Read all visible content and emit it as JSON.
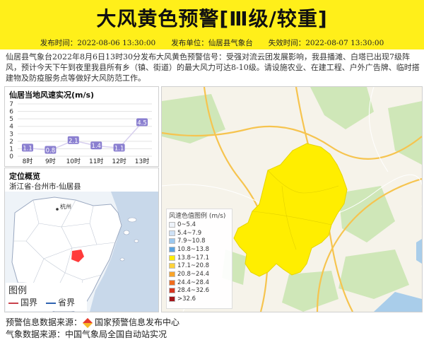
{
  "header": {
    "title": "大风黄色预警[Ⅲ级/较重]",
    "published_label": "发布时间：",
    "published": "2022-08-06 13:30:00",
    "issuer_label": "发布单位：",
    "issuer": "仙居县气象台",
    "expire_label": "失效时间：",
    "expire": "2022-08-07 13:30:00",
    "banner_color": "#ffef1a"
  },
  "description": "仙居县气象台2022年8月6日13时30分发布大风黄色预警信号：受强对流云团发展影响，我县播滩、白塔已出现7级阵风，预计今天下午到夜里我县所有乡（镇、街道）的最大风力可达8-10级。请设施农业、在建工程、户外广告牌、临时搭建物及防疫服务点等做好大风防范工作。",
  "wind_panel": {
    "title": "仙居当地风速实况(m/s)"
  },
  "chart_data": {
    "type": "line",
    "title": "仙居当地风速实况(m/s)",
    "categories": [
      "8时",
      "9时",
      "10时",
      "11时",
      "12时",
      "13时"
    ],
    "series": [
      {
        "values": [
          1.1,
          0.8,
          2.1,
          1.4,
          1.1,
          4.5
        ]
      }
    ],
    "value_labels": [
      "1.1",
      "0.8",
      "2.1",
      "1.4",
      "1.1",
      "4.5"
    ],
    "yticks": [
      "0",
      "1",
      "2",
      "3",
      "4",
      "5",
      "6",
      "7"
    ],
    "ylim": [
      0,
      7
    ],
    "grid": true
  },
  "location": {
    "title": "定位概览",
    "path": "浙江省-台州市-仙居县",
    "city_label": "杭州"
  },
  "map_legend": {
    "title": "风速色值图例 (m/s)",
    "items": [
      {
        "label": "0~5.4",
        "color": "#eef3fa"
      },
      {
        "label": "5.4~7.9",
        "color": "#cfe1f5"
      },
      {
        "label": "7.9~10.8",
        "color": "#9cc8ee"
      },
      {
        "label": "10.8~13.8",
        "color": "#5aa3e0"
      },
      {
        "label": "13.8~17.1",
        "color": "#ffee00"
      },
      {
        "label": "17.1~20.8",
        "color": "#ffd23c"
      },
      {
        "label": "20.8~24.4",
        "color": "#f9a42a"
      },
      {
        "label": "24.4~28.4",
        "color": "#f06d1e"
      },
      {
        "label": "28.4~32.6",
        "color": "#d73520"
      },
      {
        "label": ">32.6",
        "color": "#a3151a"
      }
    ]
  },
  "mini_legend": {
    "title": "图例",
    "country": "国界",
    "province": "省界"
  },
  "footer": {
    "source_label": "预警信息数据来源：",
    "source": "国家预警信息发布中心",
    "data_label": "气象数据来源：",
    "data_source": "中国气象局全国自动站实况"
  }
}
